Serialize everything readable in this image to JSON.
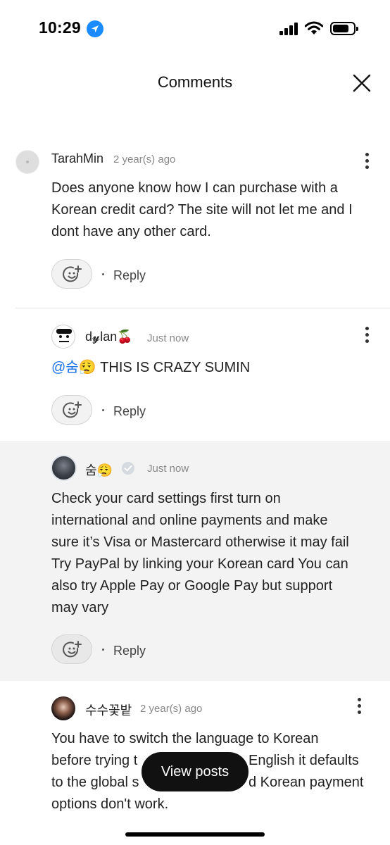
{
  "status_bar": {
    "time": "10:29"
  },
  "header": {
    "title": "Comments"
  },
  "comments": [
    {
      "username": "TarahMin",
      "timestamp": "2 year(s) ago",
      "text_lines": [
        "Does anyone know how I can purchase with a",
        "Korean credit card? The site will not let me and I",
        "dont have any other card."
      ],
      "reply_label": "Reply"
    },
    {
      "username": "d𝔂lan🍒",
      "timestamp": "Just now",
      "mention": "@숨😮‍💨",
      "text": " THIS IS CRAZY SUMIN",
      "reply_label": "Reply"
    },
    {
      "username": "숨😮‍💨",
      "timestamp": "Just now",
      "text_lines": [
        "Check your card settings first turn on",
        "international and online payments and make",
        "sure it’s Visa or Mastercard otherwise it may fail",
        "Try PayPal by linking your Korean card You can",
        "also try Apple Pay or Google Pay but support",
        "may vary"
      ],
      "reply_label": "Reply"
    },
    {
      "username": "수수꽃밭",
      "timestamp": "2 year(s) ago",
      "text_lines": [
        "You have to switch the language to Korean",
        "before trying t",
        "to the global s",
        "options don't work."
      ],
      "text_fragments": [
        "English it defaults",
        "d Korean payment"
      ]
    }
  ],
  "view_posts_button": {
    "label": "View posts"
  },
  "colors": {
    "mention": "#1a73e8",
    "highlight_bg": "#f3f3f3",
    "accent_location": "#1a8cff"
  }
}
